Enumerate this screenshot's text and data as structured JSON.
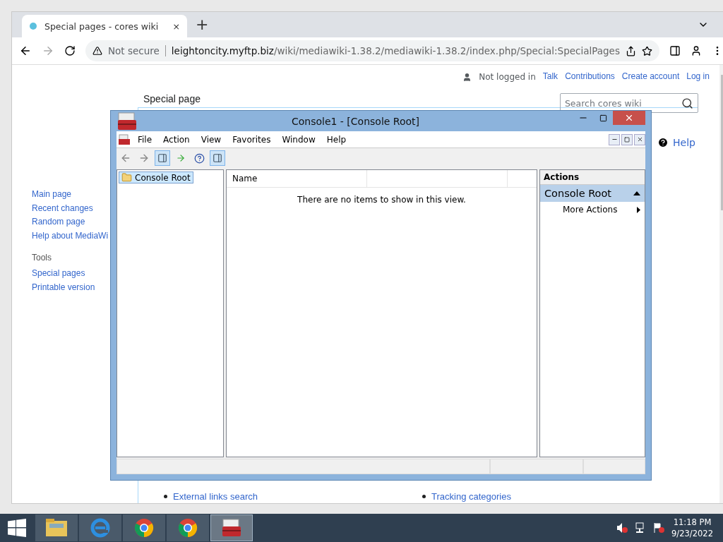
{
  "browser": {
    "tab": {
      "title": "Special pages - cores wiki",
      "close": "×"
    },
    "new_tab": "+",
    "address": {
      "security": "Not secure",
      "host": "leightoncity.myftp.biz",
      "path": "/wiki/mediawiki-1.38.2/mediawiki-1.38.2/index.php/Special:SpecialPages"
    }
  },
  "wiki": {
    "personal": {
      "user": "Not logged in",
      "links": [
        "Talk",
        "Contributions",
        "Create account",
        "Log in"
      ]
    },
    "search": {
      "placeholder": "Search cores wiki"
    },
    "heading": "Special page",
    "help": "Help",
    "nav": [
      "Main page",
      "Recent changes",
      "Random page",
      "Help about MediaWi"
    ],
    "tools": {
      "title": "Tools",
      "items": [
        "Special pages",
        "Printable version"
      ]
    },
    "list_items": [
      "External links search",
      "Tracking categories"
    ]
  },
  "console": {
    "title": "Console1 - [Console Root]",
    "menu": [
      "File",
      "Action",
      "View",
      "Favorites",
      "Window",
      "Help"
    ],
    "tree": [
      {
        "label": "Console Root",
        "selected": true
      }
    ],
    "columns": [
      "Name"
    ],
    "empty_message": "There are no items to show in this view.",
    "actions": {
      "title": "Actions",
      "section": {
        "label": "Console Root",
        "expanded": true
      },
      "items": [
        "More Actions"
      ]
    }
  },
  "taskbar": {
    "apps": [
      {
        "kind": "explorer",
        "selected": false
      },
      {
        "kind": "ie",
        "selected": false
      },
      {
        "kind": "chrome",
        "selected": false
      },
      {
        "kind": "chrome",
        "selected": false
      },
      {
        "kind": "toolbox",
        "selected": true
      }
    ],
    "time": "11:18 PM",
    "date": "9/23/2022"
  }
}
